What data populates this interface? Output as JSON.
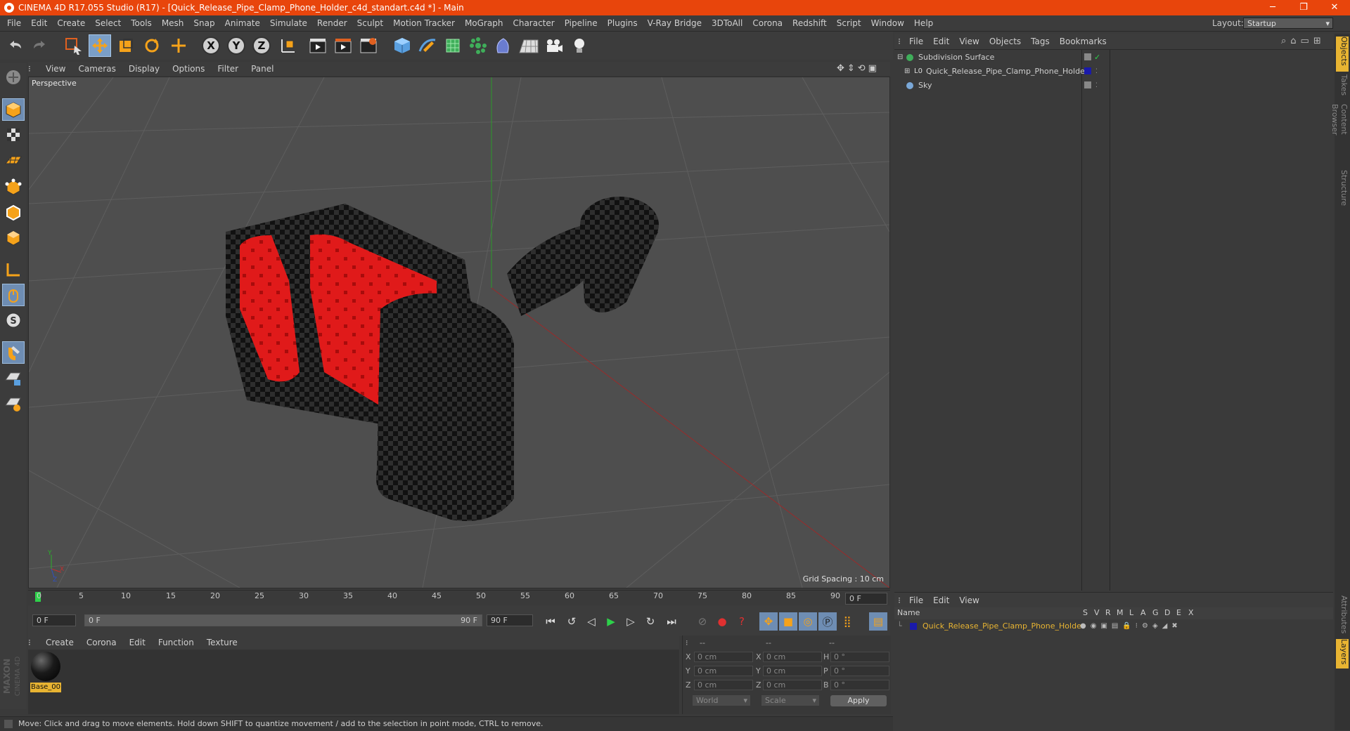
{
  "window": {
    "title": "CINEMA 4D R17.055 Studio (R17) - [Quick_Release_Pipe_Clamp_Phone_Holder_c4d_standart.c4d *] - Main",
    "controls": [
      "─",
      "❐",
      "✕"
    ]
  },
  "menubar": {
    "items": [
      "File",
      "Edit",
      "Create",
      "Select",
      "Tools",
      "Mesh",
      "Snap",
      "Animate",
      "Simulate",
      "Render",
      "Sculpt",
      "Motion Tracker",
      "MoGraph",
      "Character",
      "Pipeline",
      "Plugins",
      "V-Ray Bridge",
      "3DToAll",
      "Corona",
      "Redshift",
      "Script",
      "Window",
      "Help"
    ],
    "layout_label": "Layout:",
    "layout_value": "Startup"
  },
  "toolbar": {
    "axis_x": "X",
    "axis_y": "Y",
    "axis_z": "Z",
    "icons": [
      "undo-icon",
      "redo-icon",
      "live-selection-icon",
      "move-icon",
      "scale-icon",
      "rotate-icon",
      "last-tool-icon",
      "x-axis-icon",
      "y-axis-icon",
      "z-axis-icon",
      "coordinate-system-icon",
      "render-view-icon",
      "render-to-picture-viewer-icon",
      "render-settings-icon",
      "cube-object-icon",
      "pen-spline-icon",
      "subdivision-icon",
      "array-icon",
      "deformer-icon",
      "floor-icon",
      "camera-icon",
      "light-icon"
    ]
  },
  "viewport": {
    "menu": [
      "View",
      "Cameras",
      "Display",
      "Options",
      "Filter",
      "Panel"
    ],
    "label": "Perspective",
    "grid_spacing": "Grid Spacing : 10 cm",
    "axis_y": "Y",
    "axis_x": "X",
    "axis_z": "Z"
  },
  "timeline": {
    "ticks": [
      "0",
      "5",
      "10",
      "15",
      "20",
      "25",
      "30",
      "35",
      "40",
      "45",
      "50",
      "55",
      "60",
      "65",
      "70",
      "75",
      "80",
      "85",
      "90"
    ],
    "current_frame": "0 F"
  },
  "transport": {
    "start_field": "0 F",
    "range_start": "0 F",
    "range_end": "90 F",
    "end_field": "90 F"
  },
  "material_manager": {
    "menu": [
      "Create",
      "Corona",
      "Edit",
      "Function",
      "Texture"
    ],
    "materials": [
      {
        "name": "Base_00"
      }
    ]
  },
  "coordinates": {
    "header": [
      "--",
      "--",
      "--"
    ],
    "rows": [
      {
        "axis": "X",
        "pos": "0 cm",
        "size_axis": "X",
        "size": "0 cm",
        "rot_axis": "H",
        "rot": "0 °"
      },
      {
        "axis": "Y",
        "pos": "0 cm",
        "size_axis": "Y",
        "size": "0 cm",
        "rot_axis": "P",
        "rot": "0 °"
      },
      {
        "axis": "Z",
        "pos": "0 cm",
        "size_axis": "Z",
        "size": "0 cm",
        "rot_axis": "B",
        "rot": "0 °"
      }
    ],
    "space": "World",
    "mode": "Scale",
    "apply": "Apply"
  },
  "status": {
    "message": "Move: Click and drag to move elements. Hold down SHIFT to quantize movement / add to the selection in point mode, CTRL to remove."
  },
  "object_manager": {
    "menu": [
      "File",
      "Edit",
      "View",
      "Objects",
      "Tags",
      "Bookmarks"
    ],
    "objects": [
      {
        "name": "Subdivision Surface",
        "indent": 0
      },
      {
        "name": "Quick_Release_Pipe_Clamp_Phone_Holder",
        "indent": 1
      },
      {
        "name": "Sky",
        "indent": 0
      }
    ]
  },
  "right_tabs": [
    "Objects",
    "Takes",
    "Content Browser",
    "Structure",
    "Attributes",
    "Layers"
  ],
  "layer_manager": {
    "menu": [
      "File",
      "Edit",
      "View"
    ],
    "columns": [
      "Name",
      "S",
      "V",
      "R",
      "M",
      "L",
      "A",
      "G",
      "D",
      "E",
      "X"
    ],
    "layers": [
      {
        "name": "Quick_Release_Pipe_Clamp_Phone_Holder",
        "color": "#1a1aaa"
      }
    ]
  },
  "branding": {
    "text": "MAXON CINEMA 4D"
  },
  "colors": {
    "accent": "#e8450c",
    "selection": "#7b9fc7",
    "layer_highlight": "#e8b432"
  }
}
